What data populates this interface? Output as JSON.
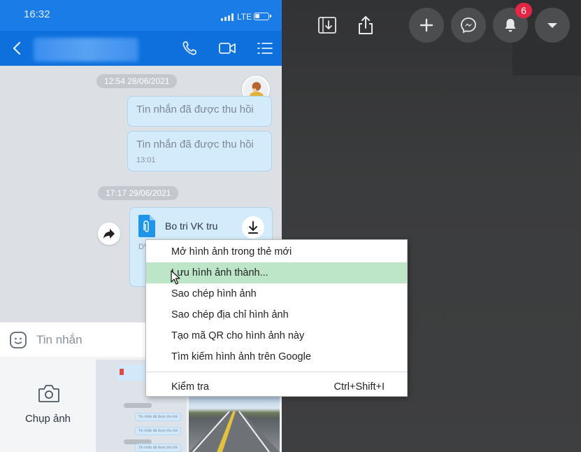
{
  "phone": {
    "status_bar": {
      "time": "16:32",
      "network": "LTE"
    },
    "chat": {
      "date_1": "12:54 28/06/2021",
      "recalled_1": "Tin nhắn đã được thu hồi",
      "recalled_2": "Tin nhắn đã được thu hồi",
      "recalled_2_time": "13:01",
      "date_2": "17:17 29/06/2021",
      "file_name": "Bo tri VK tru",
      "file_meta": "DV"
    },
    "input": {
      "placeholder": "Tin nhắn"
    },
    "media_picker": {
      "camera_label": "Chụp ảnh",
      "thumb_texts": [
        "Tin nhắn đã được thu hồi",
        "Tin nhắn đã được thu hồi",
        "Tin nhắn đã được thu hồi"
      ]
    }
  },
  "toolbar": {
    "icons": [
      "download-icon",
      "share-icon",
      "plus-icon",
      "messenger-icon",
      "bell-icon",
      "caret-down-icon"
    ],
    "notification_count": "6",
    "colors": {
      "button_bg": "#4c4d4f",
      "badge_bg": "#e42645"
    }
  },
  "context_menu": {
    "items": [
      {
        "label": "Mở hình ảnh trong thẻ mới"
      },
      {
        "label": "Lưu hình ảnh thành..."
      },
      {
        "label": "Sao chép hình ảnh"
      },
      {
        "label": "Sao chép địa chỉ hình ảnh"
      },
      {
        "label": "Tạo mã QR cho hình ảnh này"
      },
      {
        "label": "Tìm kiếm hình ảnh trên Google"
      }
    ],
    "inspect": {
      "label": "Kiểm tra",
      "shortcut": "Ctrl+Shift+I"
    },
    "highlighted_index": 1,
    "highlight_color": "#bde6c9"
  }
}
